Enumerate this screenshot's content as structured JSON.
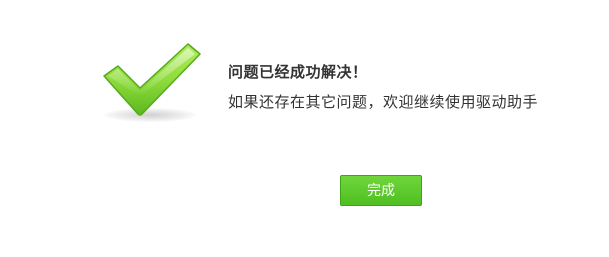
{
  "dialog": {
    "title": "问题已经成功解决！",
    "message": "如果还存在其它问题，欢迎继续使用驱动助手",
    "done_label": "完成",
    "icon": "checkmark-icon"
  },
  "colors": {
    "accent_green": "#5ec62b",
    "check_light": "#9be34a",
    "check_dark": "#4fae17",
    "text": "#333333",
    "background": "#ffffff"
  }
}
